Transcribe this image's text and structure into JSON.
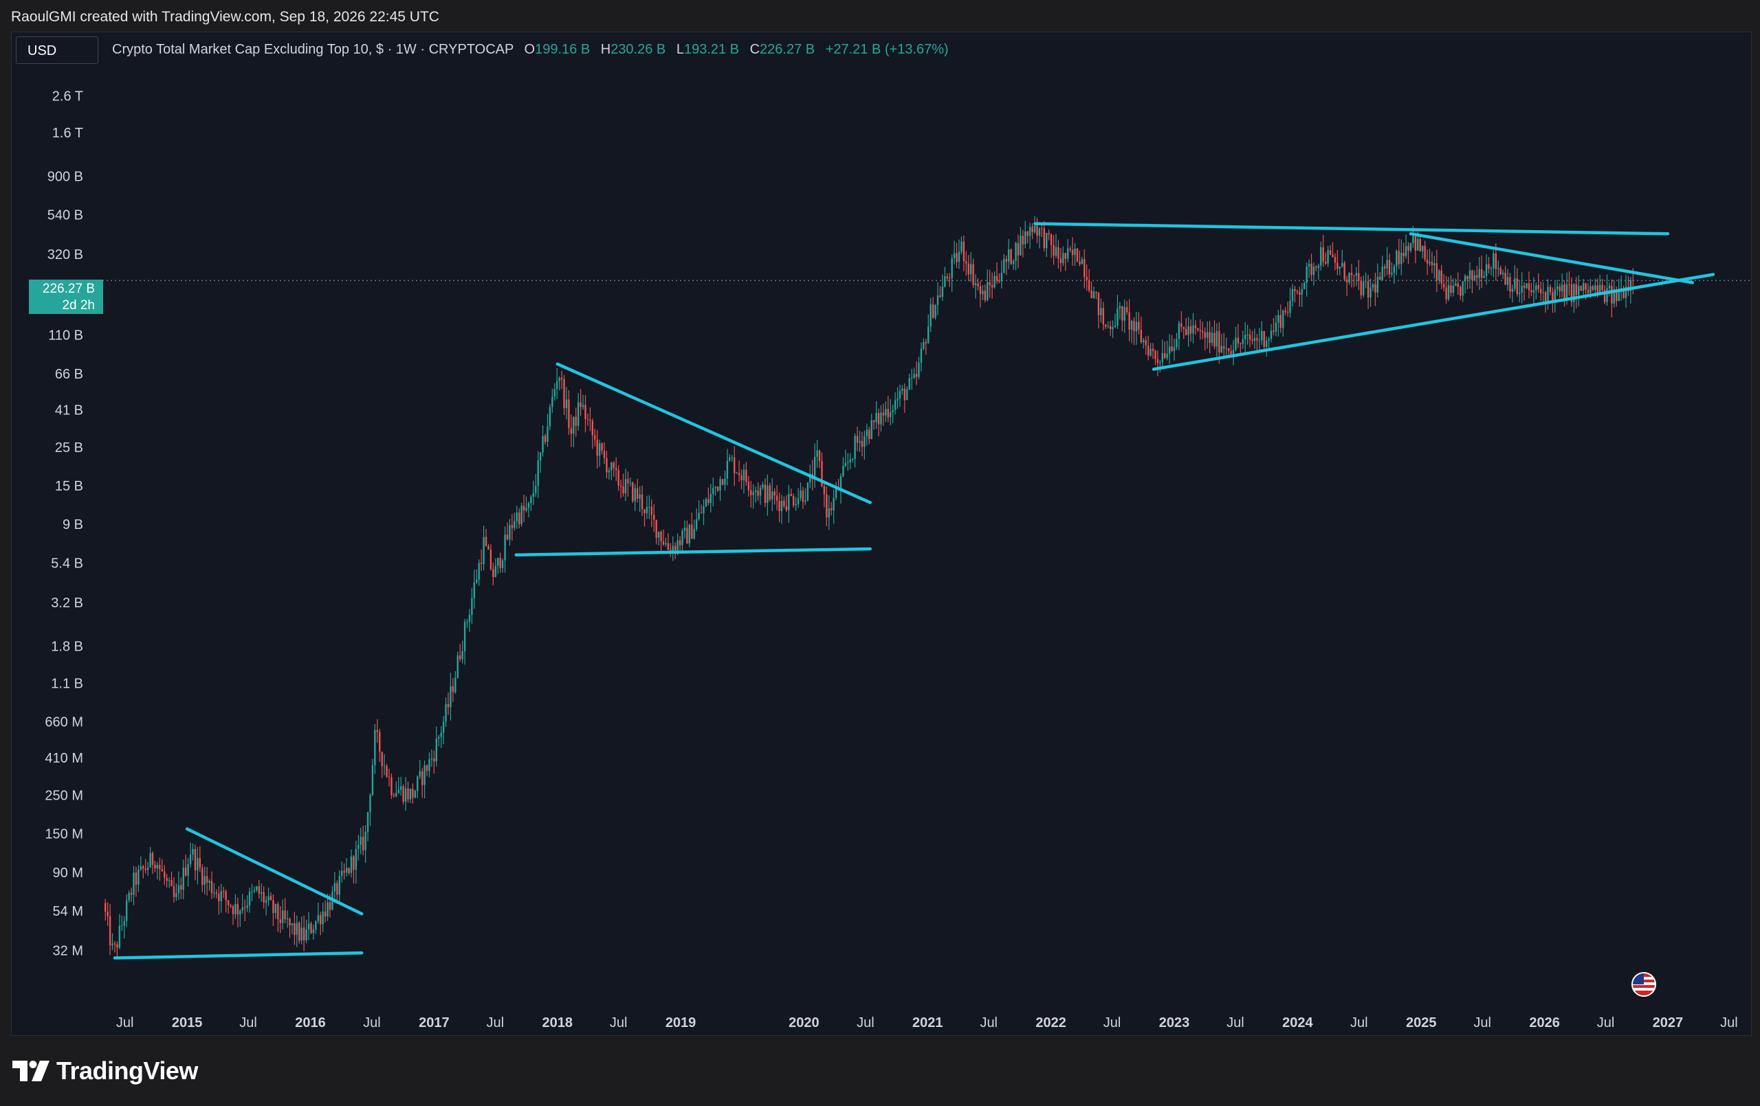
{
  "attribution": "RaoulGMI created with TradingView.com, Sep 18, 2026 22:45 UTC",
  "currency": "USD",
  "legend": {
    "symbol": "Crypto Total Market Cap Excluding Top 10, $ · 1W · CRYPTOCAP",
    "open_label": "O",
    "open_value": "199.16 B",
    "high_label": "H",
    "high_value": "230.26 B",
    "low_label": "L",
    "low_value": "193.21 B",
    "close_label": "C",
    "close_value": "226.27 B",
    "change": "+27.21 B (+13.67%)"
  },
  "price_badge": {
    "price": "226.27 B",
    "countdown": "2d 2h"
  },
  "brand": "TradingView",
  "colors": {
    "background": "#131722",
    "up": "#26a69a",
    "down": "#ef5350",
    "trendline": "#1fc6e0",
    "axis_text": "#d1d4dc"
  },
  "chart_data": {
    "type": "candlestick",
    "title": "Crypto Total Market Cap Excluding Top 10, $ · 1W · CRYPTOCAP",
    "interval": "1W",
    "y_scale": "log",
    "grid": false,
    "ylim": [
      18000000,
      3500000000000
    ],
    "xlim": [
      "2014-04-01",
      "2027-08-15"
    ],
    "y_ticks": [
      {
        "value": 2600000000000,
        "label": "2.6 T"
      },
      {
        "value": 1600000000000,
        "label": "1.6 T"
      },
      {
        "value": 900000000000,
        "label": "900 B"
      },
      {
        "value": 540000000000,
        "label": "540 B"
      },
      {
        "value": 320000000000,
        "label": "320 B"
      },
      {
        "value": 110000000000,
        "label": "110 B"
      },
      {
        "value": 66000000000,
        "label": "66 B"
      },
      {
        "value": 41000000000,
        "label": "41 B"
      },
      {
        "value": 25000000000,
        "label": "25 B"
      },
      {
        "value": 15000000000,
        "label": "15 B"
      },
      {
        "value": 9000000000,
        "label": "9 B"
      },
      {
        "value": 5400000000,
        "label": "5.4 B"
      },
      {
        "value": 3200000000,
        "label": "3.2 B"
      },
      {
        "value": 1800000000,
        "label": "1.8 B"
      },
      {
        "value": 1100000000,
        "label": "1.1 B"
      },
      {
        "value": 660000000,
        "label": "660 M"
      },
      {
        "value": 410000000,
        "label": "410 M"
      },
      {
        "value": 250000000,
        "label": "250 M"
      },
      {
        "value": 150000000,
        "label": "150 M"
      },
      {
        "value": 90000000,
        "label": "90 M"
      },
      {
        "value": 54000000,
        "label": "54 M"
      },
      {
        "value": 32000000,
        "label": "32 M"
      }
    ],
    "x_ticks": [
      {
        "date": "2014-07-01",
        "label": "Jul",
        "bold": false
      },
      {
        "date": "2015-01-01",
        "label": "2015",
        "bold": true
      },
      {
        "date": "2015-07-01",
        "label": "Jul",
        "bold": false
      },
      {
        "date": "2016-01-01",
        "label": "2016",
        "bold": true
      },
      {
        "date": "2016-07-01",
        "label": "Jul",
        "bold": false
      },
      {
        "date": "2017-01-01",
        "label": "2017",
        "bold": true
      },
      {
        "date": "2017-07-01",
        "label": "Jul",
        "bold": false
      },
      {
        "date": "2018-01-01",
        "label": "2018",
        "bold": true
      },
      {
        "date": "2018-07-01",
        "label": "Jul",
        "bold": false
      },
      {
        "date": "2019-01-01",
        "label": "2019",
        "bold": true
      },
      {
        "date": "2020-01-01",
        "label": "2020",
        "bold": true
      },
      {
        "date": "2020-07-01",
        "label": "Jul",
        "bold": false
      },
      {
        "date": "2021-01-01",
        "label": "2021",
        "bold": true
      },
      {
        "date": "2021-07-01",
        "label": "Jul",
        "bold": false
      },
      {
        "date": "2022-01-01",
        "label": "2022",
        "bold": true
      },
      {
        "date": "2022-07-01",
        "label": "Jul",
        "bold": false
      },
      {
        "date": "2023-01-01",
        "label": "2023",
        "bold": true
      },
      {
        "date": "2023-07-01",
        "label": "Jul",
        "bold": false
      },
      {
        "date": "2024-01-01",
        "label": "2024",
        "bold": true
      },
      {
        "date": "2024-07-01",
        "label": "Jul",
        "bold": false
      },
      {
        "date": "2025-01-01",
        "label": "2025",
        "bold": true
      },
      {
        "date": "2025-07-01",
        "label": "Jul",
        "bold": false
      },
      {
        "date": "2026-01-01",
        "label": "2026",
        "bold": true
      },
      {
        "date": "2026-07-01",
        "label": "Jul",
        "bold": false
      },
      {
        "date": "2027-01-01",
        "label": "2027",
        "bold": true
      },
      {
        "date": "2027-07-01",
        "label": "Jul",
        "bold": false
      }
    ],
    "last_price": 226270000000,
    "price_path": [
      [
        "2014-05-01",
        60000000
      ],
      [
        "2014-06-01",
        30000000
      ],
      [
        "2014-08-01",
        80000000
      ],
      [
        "2014-10-01",
        110000000
      ],
      [
        "2014-12-01",
        60000000
      ],
      [
        "2015-01-15",
        120000000
      ],
      [
        "2015-03-01",
        80000000
      ],
      [
        "2015-06-01",
        55000000
      ],
      [
        "2015-08-01",
        70000000
      ],
      [
        "2015-10-01",
        50000000
      ],
      [
        "2015-12-15",
        38000000
      ],
      [
        "2016-03-01",
        60000000
      ],
      [
        "2016-06-15",
        140000000
      ],
      [
        "2016-07-15",
        550000000
      ],
      [
        "2016-09-01",
        280000000
      ],
      [
        "2016-11-01",
        250000000
      ],
      [
        "2017-01-01",
        420000000
      ],
      [
        "2017-02-15",
        800000000
      ],
      [
        "2017-04-01",
        2000000000
      ],
      [
        "2017-06-01",
        7000000000
      ],
      [
        "2017-07-01",
        4500000000
      ],
      [
        "2017-09-01",
        10000000000
      ],
      [
        "2017-10-15",
        11000000000
      ],
      [
        "2017-12-01",
        30000000000
      ],
      [
        "2018-01-08",
        70000000000
      ],
      [
        "2018-02-15",
        30000000000
      ],
      [
        "2018-03-15",
        45000000000
      ],
      [
        "2018-05-01",
        25000000000
      ],
      [
        "2018-07-01",
        16000000000
      ],
      [
        "2018-09-01",
        13000000000
      ],
      [
        "2018-12-01",
        6500000000
      ],
      [
        "2019-02-01",
        8000000000
      ],
      [
        "2019-06-01",
        21000000000
      ],
      [
        "2019-08-01",
        15000000000
      ],
      [
        "2019-11-01",
        12000000000
      ],
      [
        "2020-01-15",
        14000000000
      ],
      [
        "2020-02-15",
        22000000000
      ],
      [
        "2020-03-15",
        10000000000
      ],
      [
        "2020-06-01",
        25000000000
      ],
      [
        "2020-09-01",
        40000000000
      ],
      [
        "2020-12-01",
        60000000000
      ],
      [
        "2021-01-15",
        150000000000
      ],
      [
        "2021-04-15",
        350000000000
      ],
      [
        "2021-06-15",
        180000000000
      ],
      [
        "2021-09-01",
        300000000000
      ],
      [
        "2021-11-15",
        480000000000
      ],
      [
        "2022-02-01",
        300000000000
      ],
      [
        "2022-04-01",
        320000000000
      ],
      [
        "2022-06-15",
        120000000000
      ],
      [
        "2022-08-01",
        150000000000
      ],
      [
        "2022-11-15",
        80000000000
      ],
      [
        "2023-02-01",
        120000000000
      ],
      [
        "2023-06-15",
        95000000000
      ],
      [
        "2023-10-15",
        110000000000
      ],
      [
        "2024-03-15",
        330000000000
      ],
      [
        "2024-08-01",
        190000000000
      ],
      [
        "2024-12-10",
        400000000000
      ],
      [
        "2025-04-01",
        180000000000
      ],
      [
        "2025-08-01",
        300000000000
      ],
      [
        "2025-10-15",
        200000000000
      ],
      [
        "2026-02-01",
        190000000000
      ],
      [
        "2026-06-01",
        200000000000
      ],
      [
        "2026-08-01",
        180000000000
      ],
      [
        "2026-09-18",
        226270000000
      ]
    ],
    "trendlines": [
      {
        "from": [
          "2014-06-01",
          29000000
        ],
        "to": [
          "2016-06-01",
          31000000
        ]
      },
      {
        "from": [
          "2015-01-01",
          160000000
        ],
        "to": [
          "2016-06-01",
          52000000
        ]
      },
      {
        "from": [
          "2017-09-01",
          6000000000
        ],
        "to": [
          "2020-07-15",
          6500000000
        ]
      },
      {
        "from": [
          "2018-01-01",
          75000000000
        ],
        "to": [
          "2020-07-15",
          12000000000
        ]
      },
      {
        "from": [
          "2021-11-15",
          480000000000
        ],
        "to": [
          "2027-01-01",
          420000000000
        ]
      },
      {
        "from": [
          "2022-11-01",
          70000000000
        ],
        "to": [
          "2027-05-15",
          245000000000
        ]
      },
      {
        "from": [
          "2024-12-01",
          420000000000
        ],
        "to": [
          "2027-03-15",
          220000000000
        ]
      }
    ]
  }
}
